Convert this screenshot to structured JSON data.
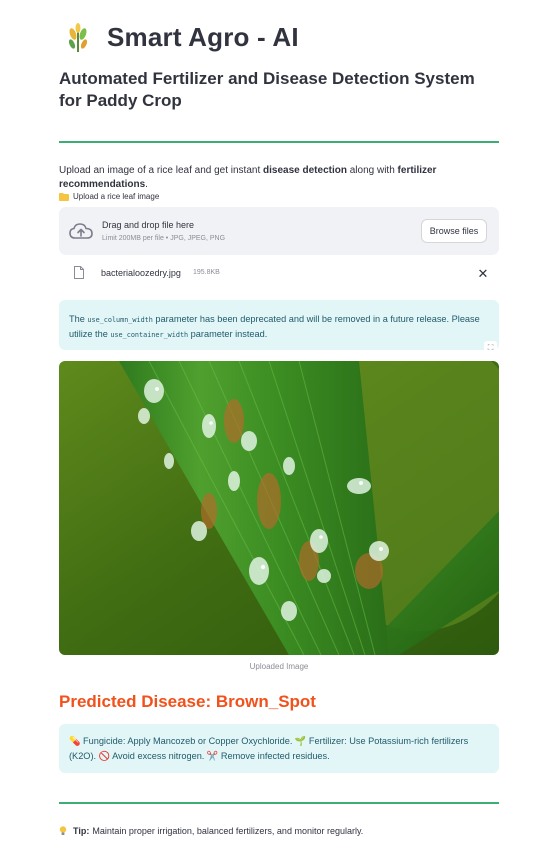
{
  "app": {
    "title": "Smart Agro - AI",
    "subtitle": "Automated Fertilizer and Disease Detection System for Paddy Crop",
    "logo_icon": "wheat-plant-icon"
  },
  "intro": {
    "prefix": "Upload an image of a rice leaf and get instant ",
    "bold1": "disease detection",
    "middle": " along with ",
    "bold2": "fertilizer recommendations",
    "suffix": "."
  },
  "uploader": {
    "label": "Upload a rice leaf image",
    "drag_text": "Drag and drop file here",
    "limit_text": "Limit 200MB per file • JPG, JPEG, PNG",
    "browse_label": "Browse files",
    "file_name": "bacterialoozedry.jpg",
    "file_size": "195.8KB"
  },
  "deprecation": {
    "p1": "The ",
    "code1": "use_column_width",
    "p2": " parameter has been deprecated and will be removed in a future release. Please utilize the ",
    "code2": "use_container_width",
    "p3": " parameter instead."
  },
  "image": {
    "caption": "Uploaded Image"
  },
  "prediction": {
    "label": "Predicted Disease: Brown_Spot",
    "recommendation": "💊 Fungicide: Apply Mancozeb or Copper Oxychloride. 🌱 Fertilizer: Use Potassium-rich fertilizers (K2O). 🚫 Avoid excess nitrogen. ✂️ Remove infected residues."
  },
  "tip": {
    "label": "Tip:",
    "text": "Maintain proper irrigation, balanced fertilizers, and monitor regularly."
  },
  "colors": {
    "accent_green": "#3cae75",
    "prediction_red": "#f1511b",
    "info_bg": "#e3f6f7",
    "info_text": "#205b6b"
  }
}
